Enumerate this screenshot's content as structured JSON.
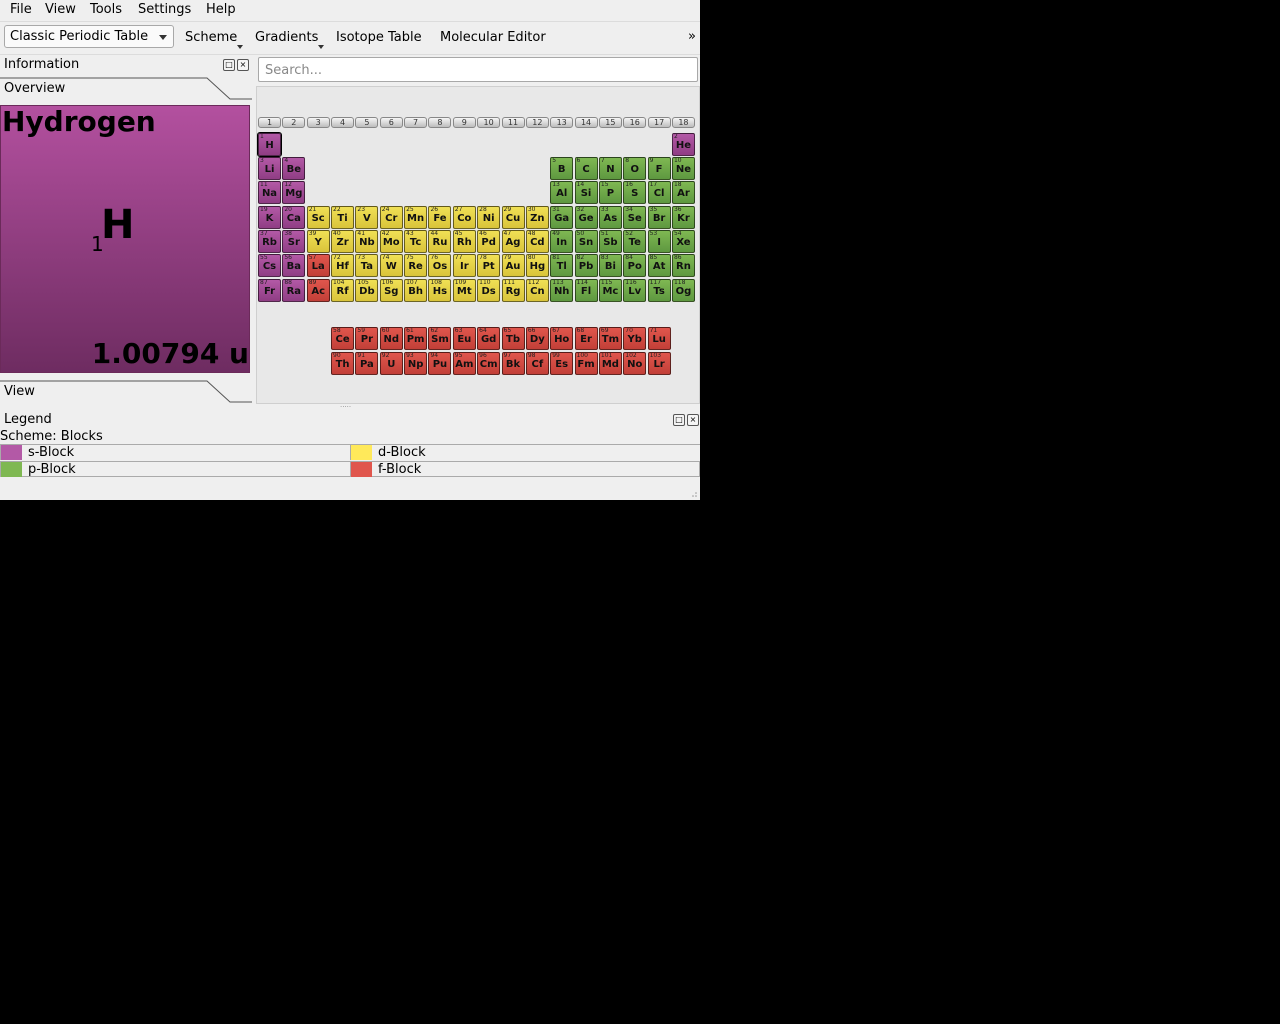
{
  "menubar": {
    "items": [
      {
        "label": "File",
        "name": "menu-file"
      },
      {
        "label": "View",
        "name": "menu-view"
      },
      {
        "label": "Tools",
        "name": "menu-tools"
      },
      {
        "label": "Settings",
        "name": "menu-settings"
      },
      {
        "label": "Help",
        "name": "menu-help"
      }
    ]
  },
  "toolbar": {
    "table_select_value": "Classic Periodic Table",
    "scheme_label": "Scheme",
    "gradients_label": "Gradients",
    "isotope_label": "Isotope Table",
    "molecular_label": "Molecular Editor",
    "extension_glyph": "»"
  },
  "info_dock": {
    "title": "Information",
    "overview_tab": "Overview",
    "view_tab": "View",
    "element": {
      "name": "Hydrogen",
      "symbol": "H",
      "number": "1",
      "mass": "1.00794 u"
    }
  },
  "search": {
    "placeholder": "Search..."
  },
  "periodic_table": {
    "groups": [
      "1",
      "2",
      "3",
      "4",
      "5",
      "6",
      "7",
      "8",
      "9",
      "10",
      "11",
      "12",
      "13",
      "14",
      "15",
      "16",
      "17",
      "18"
    ],
    "selected": "H",
    "block_colors": {
      "s": "#a8509a",
      "p": "#6fa94a",
      "d": "#e8d448",
      "f": "#d94c45"
    },
    "elements": [
      {
        "n": 1,
        "sym": "H",
        "b": "s",
        "row": 1,
        "col": 1
      },
      {
        "n": 2,
        "sym": "He",
        "b": "s",
        "row": 1,
        "col": 18
      },
      {
        "n": 3,
        "sym": "Li",
        "b": "s",
        "row": 2,
        "col": 1
      },
      {
        "n": 4,
        "sym": "Be",
        "b": "s",
        "row": 2,
        "col": 2
      },
      {
        "n": 5,
        "sym": "B",
        "b": "p",
        "row": 2,
        "col": 13
      },
      {
        "n": 6,
        "sym": "C",
        "b": "p",
        "row": 2,
        "col": 14
      },
      {
        "n": 7,
        "sym": "N",
        "b": "p",
        "row": 2,
        "col": 15
      },
      {
        "n": 8,
        "sym": "O",
        "b": "p",
        "row": 2,
        "col": 16
      },
      {
        "n": 9,
        "sym": "F",
        "b": "p",
        "row": 2,
        "col": 17
      },
      {
        "n": 10,
        "sym": "Ne",
        "b": "p",
        "row": 2,
        "col": 18
      },
      {
        "n": 11,
        "sym": "Na",
        "b": "s",
        "row": 3,
        "col": 1
      },
      {
        "n": 12,
        "sym": "Mg",
        "b": "s",
        "row": 3,
        "col": 2
      },
      {
        "n": 13,
        "sym": "Al",
        "b": "p",
        "row": 3,
        "col": 13
      },
      {
        "n": 14,
        "sym": "Si",
        "b": "p",
        "row": 3,
        "col": 14
      },
      {
        "n": 15,
        "sym": "P",
        "b": "p",
        "row": 3,
        "col": 15
      },
      {
        "n": 16,
        "sym": "S",
        "b": "p",
        "row": 3,
        "col": 16
      },
      {
        "n": 17,
        "sym": "Cl",
        "b": "p",
        "row": 3,
        "col": 17
      },
      {
        "n": 18,
        "sym": "Ar",
        "b": "p",
        "row": 3,
        "col": 18
      },
      {
        "n": 19,
        "sym": "K",
        "b": "s",
        "row": 4,
        "col": 1
      },
      {
        "n": 20,
        "sym": "Ca",
        "b": "s",
        "row": 4,
        "col": 2
      },
      {
        "n": 21,
        "sym": "Sc",
        "b": "d",
        "row": 4,
        "col": 3
      },
      {
        "n": 22,
        "sym": "Ti",
        "b": "d",
        "row": 4,
        "col": 4
      },
      {
        "n": 23,
        "sym": "V",
        "b": "d",
        "row": 4,
        "col": 5
      },
      {
        "n": 24,
        "sym": "Cr",
        "b": "d",
        "row": 4,
        "col": 6
      },
      {
        "n": 25,
        "sym": "Mn",
        "b": "d",
        "row": 4,
        "col": 7
      },
      {
        "n": 26,
        "sym": "Fe",
        "b": "d",
        "row": 4,
        "col": 8
      },
      {
        "n": 27,
        "sym": "Co",
        "b": "d",
        "row": 4,
        "col": 9
      },
      {
        "n": 28,
        "sym": "Ni",
        "b": "d",
        "row": 4,
        "col": 10
      },
      {
        "n": 29,
        "sym": "Cu",
        "b": "d",
        "row": 4,
        "col": 11
      },
      {
        "n": 30,
        "sym": "Zn",
        "b": "d",
        "row": 4,
        "col": 12
      },
      {
        "n": 31,
        "sym": "Ga",
        "b": "p",
        "row": 4,
        "col": 13
      },
      {
        "n": 32,
        "sym": "Ge",
        "b": "p",
        "row": 4,
        "col": 14
      },
      {
        "n": 33,
        "sym": "As",
        "b": "p",
        "row": 4,
        "col": 15
      },
      {
        "n": 34,
        "sym": "Se",
        "b": "p",
        "row": 4,
        "col": 16
      },
      {
        "n": 35,
        "sym": "Br",
        "b": "p",
        "row": 4,
        "col": 17
      },
      {
        "n": 36,
        "sym": "Kr",
        "b": "p",
        "row": 4,
        "col": 18
      },
      {
        "n": 37,
        "sym": "Rb",
        "b": "s",
        "row": 5,
        "col": 1
      },
      {
        "n": 38,
        "sym": "Sr",
        "b": "s",
        "row": 5,
        "col": 2
      },
      {
        "n": 39,
        "sym": "Y",
        "b": "d",
        "row": 5,
        "col": 3
      },
      {
        "n": 40,
        "sym": "Zr",
        "b": "d",
        "row": 5,
        "col": 4
      },
      {
        "n": 41,
        "sym": "Nb",
        "b": "d",
        "row": 5,
        "col": 5
      },
      {
        "n": 42,
        "sym": "Mo",
        "b": "d",
        "row": 5,
        "col": 6
      },
      {
        "n": 43,
        "sym": "Tc",
        "b": "d",
        "row": 5,
        "col": 7
      },
      {
        "n": 44,
        "sym": "Ru",
        "b": "d",
        "row": 5,
        "col": 8
      },
      {
        "n": 45,
        "sym": "Rh",
        "b": "d",
        "row": 5,
        "col": 9
      },
      {
        "n": 46,
        "sym": "Pd",
        "b": "d",
        "row": 5,
        "col": 10
      },
      {
        "n": 47,
        "sym": "Ag",
        "b": "d",
        "row": 5,
        "col": 11
      },
      {
        "n": 48,
        "sym": "Cd",
        "b": "d",
        "row": 5,
        "col": 12
      },
      {
        "n": 49,
        "sym": "In",
        "b": "p",
        "row": 5,
        "col": 13
      },
      {
        "n": 50,
        "sym": "Sn",
        "b": "p",
        "row": 5,
        "col": 14
      },
      {
        "n": 51,
        "sym": "Sb",
        "b": "p",
        "row": 5,
        "col": 15
      },
      {
        "n": 52,
        "sym": "Te",
        "b": "p",
        "row": 5,
        "col": 16
      },
      {
        "n": 53,
        "sym": "I",
        "b": "p",
        "row": 5,
        "col": 17
      },
      {
        "n": 54,
        "sym": "Xe",
        "b": "p",
        "row": 5,
        "col": 18
      },
      {
        "n": 55,
        "sym": "Cs",
        "b": "s",
        "row": 6,
        "col": 1
      },
      {
        "n": 56,
        "sym": "Ba",
        "b": "s",
        "row": 6,
        "col": 2
      },
      {
        "n": 57,
        "sym": "La",
        "b": "f",
        "row": 6,
        "col": 3
      },
      {
        "n": 72,
        "sym": "Hf",
        "b": "d",
        "row": 6,
        "col": 4
      },
      {
        "n": 73,
        "sym": "Ta",
        "b": "d",
        "row": 6,
        "col": 5
      },
      {
        "n": 74,
        "sym": "W",
        "b": "d",
        "row": 6,
        "col": 6
      },
      {
        "n": 75,
        "sym": "Re",
        "b": "d",
        "row": 6,
        "col": 7
      },
      {
        "n": 76,
        "sym": "Os",
        "b": "d",
        "row": 6,
        "col": 8
      },
      {
        "n": 77,
        "sym": "Ir",
        "b": "d",
        "row": 6,
        "col": 9
      },
      {
        "n": 78,
        "sym": "Pt",
        "b": "d",
        "row": 6,
        "col": 10
      },
      {
        "n": 79,
        "sym": "Au",
        "b": "d",
        "row": 6,
        "col": 11
      },
      {
        "n": 80,
        "sym": "Hg",
        "b": "d",
        "row": 6,
        "col": 12
      },
      {
        "n": 81,
        "sym": "Tl",
        "b": "p",
        "row": 6,
        "col": 13
      },
      {
        "n": 82,
        "sym": "Pb",
        "b": "p",
        "row": 6,
        "col": 14
      },
      {
        "n": 83,
        "sym": "Bi",
        "b": "p",
        "row": 6,
        "col": 15
      },
      {
        "n": 84,
        "sym": "Po",
        "b": "p",
        "row": 6,
        "col": 16
      },
      {
        "n": 85,
        "sym": "At",
        "b": "p",
        "row": 6,
        "col": 17
      },
      {
        "n": 86,
        "sym": "Rn",
        "b": "p",
        "row": 6,
        "col": 18
      },
      {
        "n": 87,
        "sym": "Fr",
        "b": "s",
        "row": 7,
        "col": 1
      },
      {
        "n": 88,
        "sym": "Ra",
        "b": "s",
        "row": 7,
        "col": 2
      },
      {
        "n": 89,
        "sym": "Ac",
        "b": "f",
        "row": 7,
        "col": 3
      },
      {
        "n": 104,
        "sym": "Rf",
        "b": "d",
        "row": 7,
        "col": 4
      },
      {
        "n": 105,
        "sym": "Db",
        "b": "d",
        "row": 7,
        "col": 5
      },
      {
        "n": 106,
        "sym": "Sg",
        "b": "d",
        "row": 7,
        "col": 6
      },
      {
        "n": 107,
        "sym": "Bh",
        "b": "d",
        "row": 7,
        "col": 7
      },
      {
        "n": 108,
        "sym": "Hs",
        "b": "d",
        "row": 7,
        "col": 8
      },
      {
        "n": 109,
        "sym": "Mt",
        "b": "d",
        "row": 7,
        "col": 9
      },
      {
        "n": 110,
        "sym": "Ds",
        "b": "d",
        "row": 7,
        "col": 10
      },
      {
        "n": 111,
        "sym": "Rg",
        "b": "d",
        "row": 7,
        "col": 11
      },
      {
        "n": 112,
        "sym": "Cn",
        "b": "d",
        "row": 7,
        "col": 12
      },
      {
        "n": 113,
        "sym": "Nh",
        "b": "p",
        "row": 7,
        "col": 13
      },
      {
        "n": 114,
        "sym": "Fl",
        "b": "p",
        "row": 7,
        "col": 14
      },
      {
        "n": 115,
        "sym": "Mc",
        "b": "p",
        "row": 7,
        "col": 15
      },
      {
        "n": 116,
        "sym": "Lv",
        "b": "p",
        "row": 7,
        "col": 16
      },
      {
        "n": 117,
        "sym": "Ts",
        "b": "p",
        "row": 7,
        "col": 17
      },
      {
        "n": 118,
        "sym": "Og",
        "b": "p",
        "row": 7,
        "col": 18
      },
      {
        "n": 58,
        "sym": "Ce",
        "b": "f",
        "row": 9,
        "col": 4
      },
      {
        "n": 59,
        "sym": "Pr",
        "b": "f",
        "row": 9,
        "col": 5
      },
      {
        "n": 60,
        "sym": "Nd",
        "b": "f",
        "row": 9,
        "col": 6
      },
      {
        "n": 61,
        "sym": "Pm",
        "b": "f",
        "row": 9,
        "col": 7
      },
      {
        "n": 62,
        "sym": "Sm",
        "b": "f",
        "row": 9,
        "col": 8
      },
      {
        "n": 63,
        "sym": "Eu",
        "b": "f",
        "row": 9,
        "col": 9
      },
      {
        "n": 64,
        "sym": "Gd",
        "b": "f",
        "row": 9,
        "col": 10
      },
      {
        "n": 65,
        "sym": "Tb",
        "b": "f",
        "row": 9,
        "col": 11
      },
      {
        "n": 66,
        "sym": "Dy",
        "b": "f",
        "row": 9,
        "col": 12
      },
      {
        "n": 67,
        "sym": "Ho",
        "b": "f",
        "row": 9,
        "col": 13
      },
      {
        "n": 68,
        "sym": "Er",
        "b": "f",
        "row": 9,
        "col": 14
      },
      {
        "n": 69,
        "sym": "Tm",
        "b": "f",
        "row": 9,
        "col": 15
      },
      {
        "n": 70,
        "sym": "Yb",
        "b": "f",
        "row": 9,
        "col": 16
      },
      {
        "n": 71,
        "sym": "Lu",
        "b": "f",
        "row": 9,
        "col": 17
      },
      {
        "n": 90,
        "sym": "Th",
        "b": "f",
        "row": 10,
        "col": 4
      },
      {
        "n": 91,
        "sym": "Pa",
        "b": "f",
        "row": 10,
        "col": 5
      },
      {
        "n": 92,
        "sym": "U",
        "b": "f",
        "row": 10,
        "col": 6
      },
      {
        "n": 93,
        "sym": "Np",
        "b": "f",
        "row": 10,
        "col": 7
      },
      {
        "n": 94,
        "sym": "Pu",
        "b": "f",
        "row": 10,
        "col": 8
      },
      {
        "n": 95,
        "sym": "Am",
        "b": "f",
        "row": 10,
        "col": 9
      },
      {
        "n": 96,
        "sym": "Cm",
        "b": "f",
        "row": 10,
        "col": 10
      },
      {
        "n": 97,
        "sym": "Bk",
        "b": "f",
        "row": 10,
        "col": 11
      },
      {
        "n": 98,
        "sym": "Cf",
        "b": "f",
        "row": 10,
        "col": 12
      },
      {
        "n": 99,
        "sym": "Es",
        "b": "f",
        "row": 10,
        "col": 13
      },
      {
        "n": 100,
        "sym": "Fm",
        "b": "f",
        "row": 10,
        "col": 14
      },
      {
        "n": 101,
        "sym": "Md",
        "b": "f",
        "row": 10,
        "col": 15
      },
      {
        "n": 102,
        "sym": "No",
        "b": "f",
        "row": 10,
        "col": 16
      },
      {
        "n": 103,
        "sym": "Lr",
        "b": "f",
        "row": 10,
        "col": 17
      }
    ]
  },
  "legend": {
    "title": "Legend",
    "scheme": "Scheme: Blocks",
    "items": [
      {
        "label": "s-Block",
        "color": "#b359a6"
      },
      {
        "label": "d-Block",
        "color": "#ffe95a"
      },
      {
        "label": "p-Block",
        "color": "#7fb852"
      },
      {
        "label": "f-Block",
        "color": "#e0564d"
      }
    ]
  }
}
